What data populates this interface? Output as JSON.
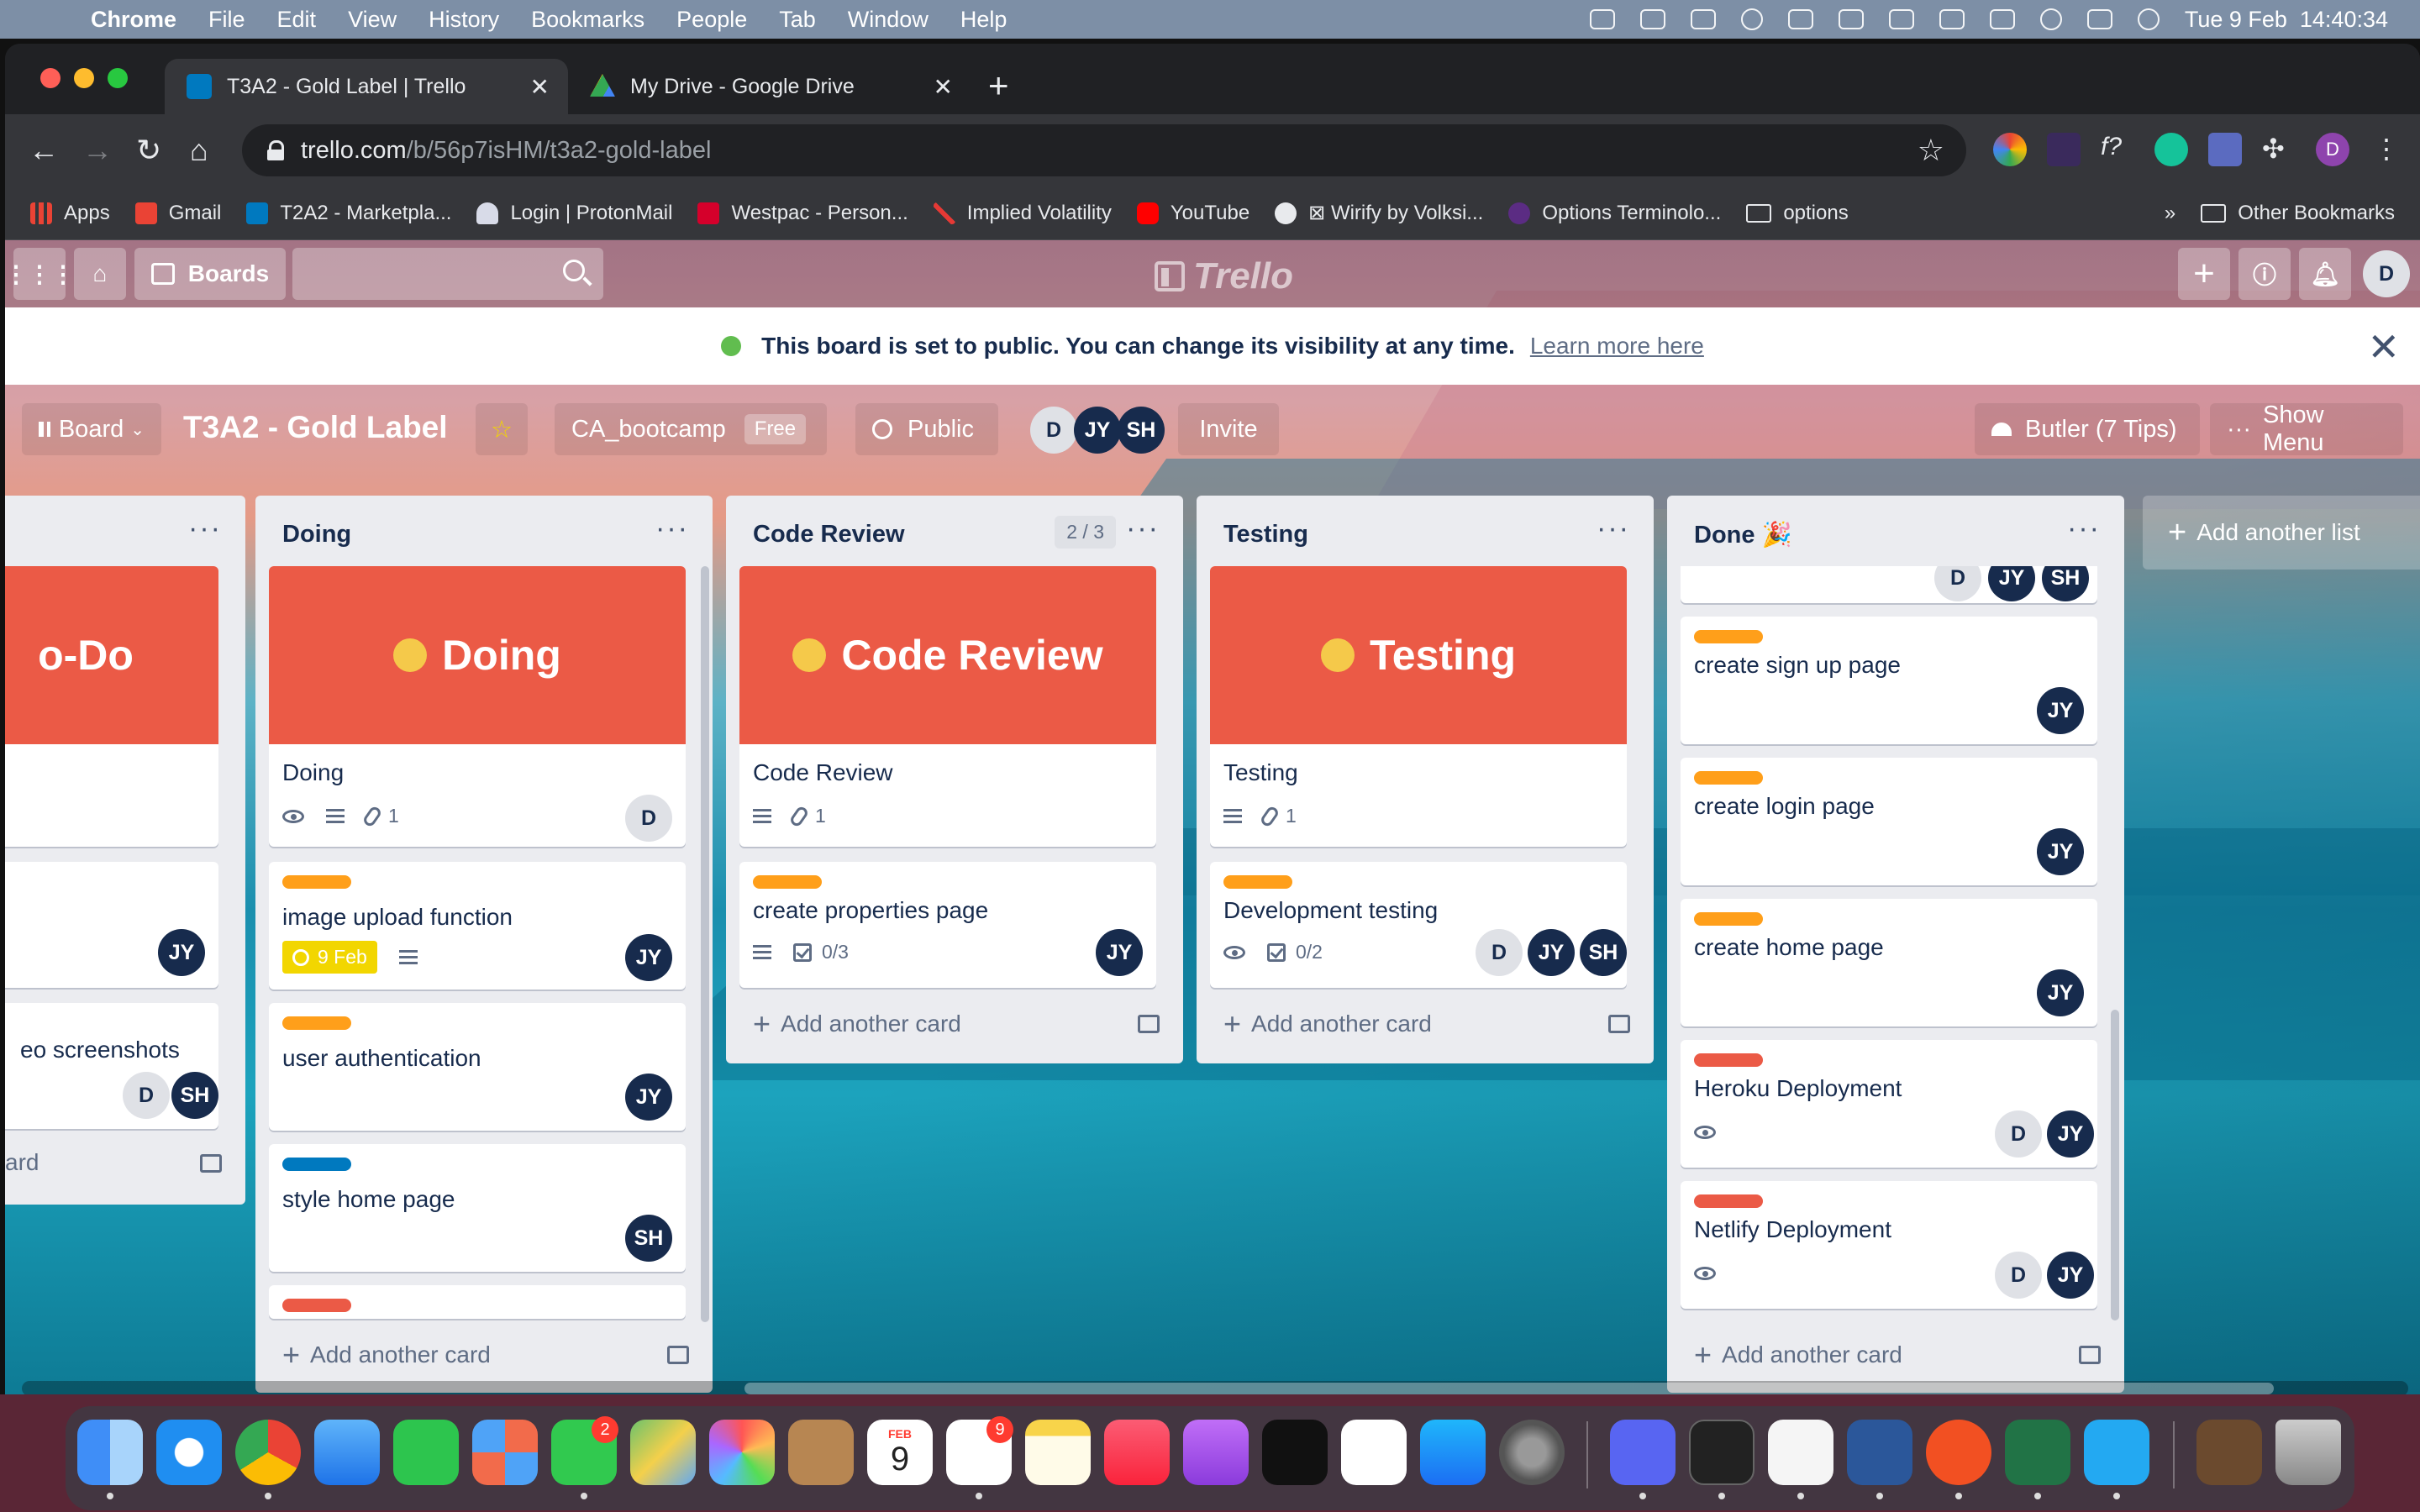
{
  "menubar": {
    "app_name": "Chrome",
    "items": [
      "File",
      "Edit",
      "View",
      "History",
      "Bookmarks",
      "People",
      "Tab",
      "Window",
      "Help"
    ],
    "datetime": "Tue 9 Feb  14:40:34"
  },
  "browser": {
    "tabs": [
      {
        "title": "T3A2 - Gold Label | Trello",
        "active": true
      },
      {
        "title": "My Drive - Google Drive",
        "active": false
      }
    ],
    "url_domain": "trello.com",
    "url_path": "/b/56p7isHM/t3a2-gold-label",
    "profile_initial": "D",
    "bookmarks": [
      "Apps",
      "Gmail",
      "T2A2 - Marketpla...",
      "Login | ProtonMail",
      "Westpac - Person...",
      "Implied Volatility",
      "YouTube",
      "⊠ Wirify by Volksi...",
      "Options Terminolo...",
      "options"
    ],
    "bookmarks_overflow": "»",
    "other_bookmarks": "Other Bookmarks"
  },
  "trello_header": {
    "boards_label": "Boards",
    "logo_text": "Trello",
    "user_initial": "D"
  },
  "banner": {
    "message": "This board is set to public. You can change its visibility at any time.",
    "link": "Learn more here",
    "close": "✕"
  },
  "board": {
    "view_label": "Board",
    "title": "T3A2 - Gold Label",
    "team": "CA_bootcamp",
    "team_tier": "Free",
    "visibility": "Public",
    "members": [
      "D",
      "JY",
      "SH"
    ],
    "invite": "Invite",
    "butler": "Butler (7 Tips)",
    "show_menu": "Show Menu",
    "add_list": "Add another list"
  },
  "lists": {
    "todo": {
      "cover_text": "o-Do",
      "card2_members": [
        "JY"
      ],
      "card3_title": "eo screenshots",
      "card3_members": [
        "D",
        "SH"
      ],
      "add_text": "ard"
    },
    "doing": {
      "name": "Doing",
      "cover_text": "Doing",
      "cover_card_title": "Doing",
      "cover_card_attachments": "1",
      "cover_card_members": [
        "D"
      ],
      "cards": [
        {
          "title": "image upload function",
          "due": "9 Feb",
          "members": [
            "JY"
          ],
          "label_color": "#ff9f1a"
        },
        {
          "title": "user authentication",
          "members": [
            "JY"
          ],
          "label_color": "#ff9f1a"
        },
        {
          "title": "style home page",
          "members": [
            "SH"
          ],
          "label_color": "#0079bf"
        }
      ],
      "add_card": "Add another card"
    },
    "code_review": {
      "name": "Code Review",
      "count": "2 / 3",
      "cover_text": "Code Review",
      "cover_card_title": "Code Review",
      "cover_card_attachments": "1",
      "cards": [
        {
          "title": "create properties page",
          "checklist": "0/3",
          "members": [
            "JY"
          ],
          "label_color": "#ff9f1a"
        }
      ],
      "add_card": "Add another card"
    },
    "testing": {
      "name": "Testing",
      "cover_text": "Testing",
      "cover_card_title": "Testing",
      "cover_card_attachments": "1",
      "cards": [
        {
          "title": "Development testing",
          "checklist": "0/2",
          "members": [
            "D",
            "JY",
            "SH"
          ],
          "label_color": "#ff9f1a"
        }
      ],
      "add_card": "Add another card"
    },
    "done": {
      "name": "Done 🎉",
      "top_members": [
        "D",
        "JY",
        "SH"
      ],
      "cards": [
        {
          "title": "create sign up page",
          "members": [
            "JY"
          ],
          "label_color": "#ff9f1a"
        },
        {
          "title": "create login page",
          "members": [
            "JY"
          ],
          "label_color": "#ff9f1a"
        },
        {
          "title": "create home page",
          "members": [
            "JY"
          ],
          "label_color": "#ff9f1a"
        },
        {
          "title": "Heroku Deployment",
          "members": [
            "D",
            "JY"
          ],
          "label_color": "#eb5a46"
        },
        {
          "title": "Netlify Deployment",
          "members": [
            "D",
            "JY"
          ],
          "label_color": "#eb5a46"
        }
      ],
      "add_card": "Add another card"
    }
  },
  "dock": {
    "calendar_month": "FEB",
    "calendar_day": "9",
    "messages_badge": "2",
    "reminders_badge": "9"
  },
  "colors": {
    "cover_red": "#eb5a46",
    "label_orange": "#ff9f1a",
    "label_blue": "#0079bf",
    "label_red": "#eb5a46",
    "avatar_dark": "#172b4d"
  }
}
